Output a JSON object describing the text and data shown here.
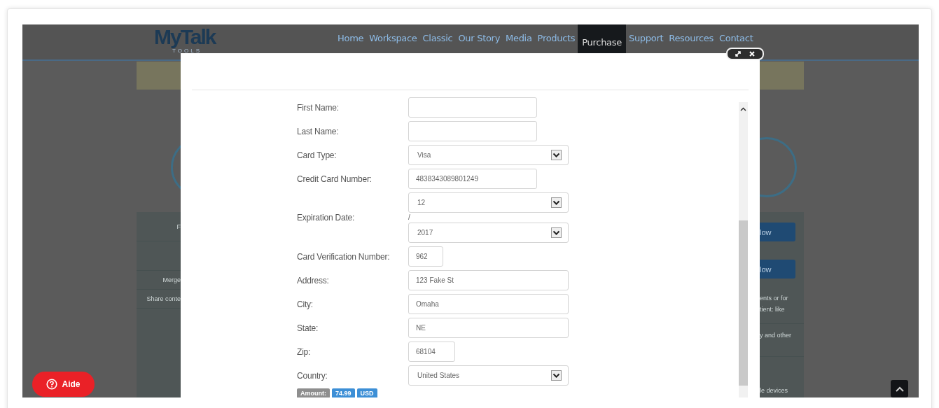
{
  "header": {
    "logo": "MyTalk",
    "logo_subtitle": "TOOLS",
    "nav": [
      {
        "label": "Home",
        "selected": false
      },
      {
        "label": "Workspace",
        "selected": false
      },
      {
        "label": "Classic",
        "selected": false
      },
      {
        "label": "Our Story",
        "selected": false
      },
      {
        "label": "Media",
        "selected": false
      },
      {
        "label": "Products",
        "selected": false
      },
      {
        "label": "Purchase",
        "selected": true
      },
      {
        "label": "Support",
        "selected": false
      },
      {
        "label": "Resources",
        "selected": false
      },
      {
        "label": "Contact",
        "selected": false
      }
    ]
  },
  "background": {
    "left_panel": [
      "F",
      "Merge",
      "Share conte"
    ],
    "right_buttons": [
      "low",
      "low"
    ],
    "right_blocks": [
      [
        "ents or for",
        "tient: like"
      ],
      [
        "y and other"
      ],
      [
        "le devices"
      ]
    ]
  },
  "modal": {
    "fields": [
      {
        "kind": "text",
        "label": "First Name:"
      },
      {
        "kind": "text",
        "label": "Last Name:"
      },
      {
        "kind": "select",
        "label": "Card Type:",
        "value": "Visa"
      },
      {
        "kind": "text",
        "label": "Credit Card Number:",
        "value": "4838343089801249"
      },
      {
        "kind": "date",
        "label": "Expiration Date:",
        "month": "12",
        "separator": "/",
        "year": "2017"
      },
      {
        "kind": "shorttext",
        "label": "Card Verification Number:",
        "value": "962"
      },
      {
        "kind": "widetext",
        "label": "Address:",
        "value": "123 Fake St"
      },
      {
        "kind": "widetext",
        "label": "City:",
        "value": "Omaha"
      },
      {
        "kind": "widetext",
        "label": "State:",
        "value": "NE"
      },
      {
        "kind": "zip",
        "label": "Zip:",
        "value": "68104"
      },
      {
        "kind": "select",
        "label": "Country:",
        "value": "United States"
      }
    ],
    "amount": {
      "label": "Amount:",
      "value": "74.99",
      "currency": "USD"
    }
  },
  "help_button": {
    "label": "Aide"
  }
}
